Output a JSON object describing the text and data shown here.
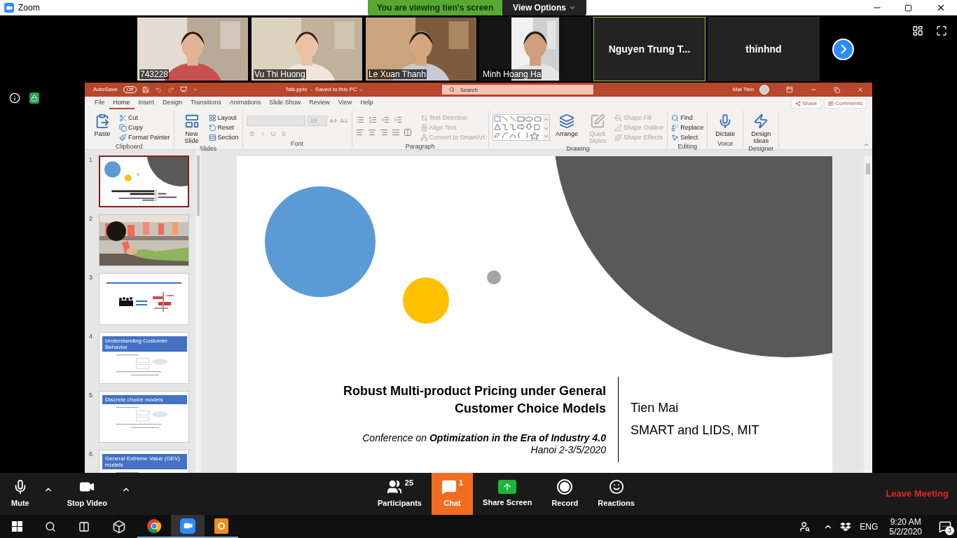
{
  "zoom_window": {
    "title": "Zoom"
  },
  "share_banner": {
    "text": "You are viewing tien's screen",
    "view_options": "View Options"
  },
  "video_strip": [
    {
      "name": "743228",
      "kind": "video",
      "active_speaker": false
    },
    {
      "name": "Vu Thi Huong",
      "kind": "video",
      "active_speaker": false
    },
    {
      "name": "Le Xuan Thanh",
      "kind": "video",
      "active_speaker": false
    },
    {
      "name": "Minh Hoang Ha",
      "kind": "pillarbox",
      "active_speaker": false
    },
    {
      "name": "Nguyen Trung T...",
      "kind": "name_only",
      "active_speaker": true
    },
    {
      "name": "thinhnd",
      "kind": "name_only",
      "active_speaker": false
    }
  ],
  "powerpoint": {
    "autosave": {
      "label": "AutoSave",
      "state": "Off",
      "on": false
    },
    "file_title": "Talk.pptx  -  Saved to this PC",
    "search_placeholder": "Search",
    "user": "Mai Tien",
    "tabs": [
      {
        "label": "File",
        "selected": false
      },
      {
        "label": "Home",
        "selected": true
      },
      {
        "label": "Insert",
        "selected": false
      },
      {
        "label": "Design",
        "selected": false
      },
      {
        "label": "Transitions",
        "selected": false
      },
      {
        "label": "Animations",
        "selected": false
      },
      {
        "label": "Slide Show",
        "selected": false
      },
      {
        "label": "Review",
        "selected": false
      },
      {
        "label": "View",
        "selected": false
      },
      {
        "label": "Help",
        "selected": false
      }
    ],
    "share": "Share",
    "comments": "Comments",
    "ribbon": [
      {
        "label": "Clipboard",
        "kind": "basic",
        "items": [
          {
            "label": "Paste",
            "kind": "large",
            "disabled": false
          },
          {
            "label": "Cut",
            "kind": "small",
            "disabled": false
          },
          {
            "label": "Copy",
            "kind": "small",
            "disabled": false
          },
          {
            "label": "Format Painter",
            "kind": "small",
            "disabled": false
          }
        ]
      },
      {
        "label": "Slides",
        "kind": "basic",
        "items": [
          {
            "label": "New Slide",
            "kind": "large",
            "disabled": false
          },
          {
            "label": "Layout",
            "kind": "small",
            "disabled": false
          },
          {
            "label": "Reset",
            "kind": "small",
            "disabled": false
          },
          {
            "label": "Section",
            "kind": "small",
            "disabled": false
          }
        ]
      },
      {
        "label": "Font",
        "kind": "font",
        "items": [
          {
            "label": "18",
            "kind": "size",
            "disabled": true
          },
          {
            "label": "B",
            "kind": "format",
            "disabled": true
          },
          {
            "label": "I",
            "kind": "format",
            "disabled": true
          },
          {
            "label": "U",
            "kind": "format",
            "disabled": true
          },
          {
            "label": "S",
            "kind": "format",
            "disabled": true
          }
        ]
      },
      {
        "label": "Paragraph",
        "kind": "paragraph",
        "items": [
          {
            "label": "Text Direction",
            "kind": "small",
            "disabled": true
          },
          {
            "label": "Align Text",
            "kind": "small",
            "disabled": true
          },
          {
            "label": "Convert to SmartArt",
            "kind": "small",
            "disabled": true
          }
        ]
      },
      {
        "label": "Drawing",
        "kind": "drawing",
        "items": [
          {
            "label": "Arrange",
            "kind": "large",
            "disabled": false
          },
          {
            "label": "Quick Styles",
            "kind": "large",
            "disabled": true
          },
          {
            "label": "Shape Fill",
            "kind": "small",
            "disabled": true
          },
          {
            "label": "Shape Outline",
            "kind": "small",
            "disabled": true
          },
          {
            "label": "Shape Effects",
            "kind": "small",
            "disabled": true
          }
        ]
      },
      {
        "label": "Editing",
        "kind": "basic",
        "items": [
          {
            "label": "Find",
            "kind": "small",
            "disabled": false
          },
          {
            "label": "Replace",
            "kind": "small",
            "disabled": false
          },
          {
            "label": "Select",
            "kind": "small",
            "disabled": false
          }
        ]
      },
      {
        "label": "Voice",
        "kind": "basic",
        "items": [
          {
            "label": "Dictate",
            "kind": "large",
            "disabled": false
          }
        ]
      },
      {
        "label": "Designer",
        "kind": "basic",
        "items": [
          {
            "label": "Design Ideas",
            "kind": "large",
            "disabled": false
          }
        ]
      }
    ],
    "thumbnails": [
      {
        "number": "1",
        "kind": "title",
        "selected": true
      },
      {
        "number": "2",
        "selected": false
      },
      {
        "number": "3",
        "kind": "diagram",
        "selected": false
      },
      {
        "number": "4",
        "kind": "header",
        "heading": "Understanding Customer Behavior",
        "selected": false
      },
      {
        "number": "5",
        "kind": "header",
        "heading": "Discrete choice models",
        "selected": false
      },
      {
        "number": "6",
        "kind": "header",
        "heading": "General Extreme Value (GEV) models",
        "selected": false
      }
    ],
    "slide": {
      "title_lines": [
        "Robust Multi-product Pricing under General",
        "Customer Choice Models"
      ],
      "author": "Tien Mai",
      "affiliation": "SMART and LIDS, MIT",
      "conference": "Conference on **Optimization in the Era of Industry 4.0**",
      "place_date": "Hanoi 2-3/5/2020"
    }
  },
  "meeting_controls": {
    "left": [
      {
        "label": "Mute",
        "kind": "mic"
      },
      {
        "label": "Stop Video",
        "kind": "camera"
      }
    ],
    "center": [
      {
        "label": "Participants",
        "kind": "participants",
        "count": "25",
        "selected": false
      },
      {
        "label": "Chat",
        "kind": "chat",
        "count": "1",
        "selected": true
      },
      {
        "label": "Share Screen",
        "kind": "share",
        "selected": false
      },
      {
        "label": "Record",
        "kind": "record",
        "selected": false
      },
      {
        "label": "Reactions",
        "kind": "reactions",
        "selected": false
      }
    ],
    "leave": "Leave Meeting"
  },
  "taskbar": {
    "language": "ENG",
    "time": "9:20 AM",
    "date": "5/2/2020",
    "notification_count": "3"
  }
}
